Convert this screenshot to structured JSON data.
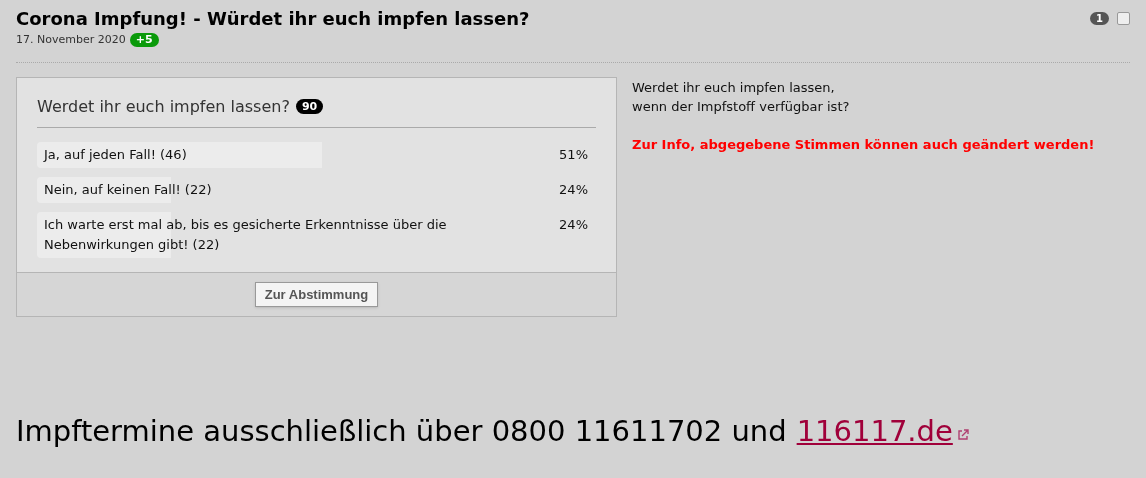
{
  "post": {
    "title": "Corona Impfung! - Würdet ihr euch impfen lassen?",
    "date": "17. November 2020",
    "score_badge": "+5",
    "comment_count": "1",
    "checked": false
  },
  "poll": {
    "question": "Werdet ihr euch impfen lassen?",
    "votes_badge": "90",
    "options": [
      {
        "label": "Ja, auf jeden Fall! (46)",
        "percent": "51%"
      },
      {
        "label": "Nein, auf keinen Fall! (22)",
        "percent": "24%"
      },
      {
        "label": "Ich warte erst mal ab, bis es gesicherte Erkenntnisse über die Nebenwirkungen gibt! (22)",
        "percent": "24%"
      }
    ],
    "button": "Zur Abstimmung"
  },
  "description": {
    "lines": [
      "Werdet ihr euch impfen lassen,",
      "wenn der Impfstoff verfügbar ist?"
    ],
    "notice": "Zur Info, abgegebene Stimmen können auch geändert werden!"
  },
  "footer": {
    "text": "Impftermine ausschließlich über 0800 11611702 und",
    "link": "116117.de"
  }
}
